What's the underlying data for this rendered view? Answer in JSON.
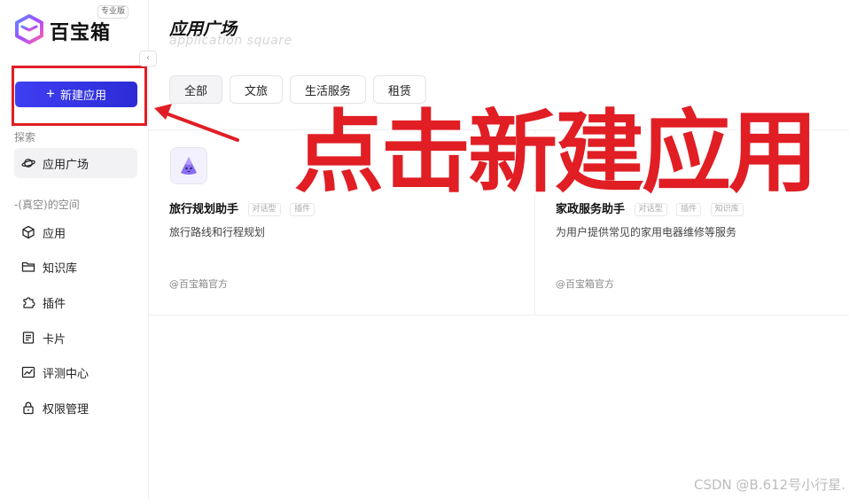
{
  "brand": {
    "name": "百宝箱",
    "edition_badge": "专业版"
  },
  "sidebar": {
    "collapse_icon": "chevron-left-icon",
    "new_app_label": "新建应用",
    "explore_section": "探索",
    "explore_items": [
      {
        "label": "应用广场",
        "icon": "planet-icon"
      }
    ],
    "space_section": "-(真空)的空间",
    "space_items": [
      {
        "label": "应用",
        "icon": "cube-icon"
      },
      {
        "label": "知识库",
        "icon": "folder-icon"
      },
      {
        "label": "插件",
        "icon": "puzzle-icon"
      },
      {
        "label": "卡片",
        "icon": "card-icon"
      },
      {
        "label": "评测中心",
        "icon": "chart-icon"
      },
      {
        "label": "权限管理",
        "icon": "lock-icon"
      }
    ]
  },
  "main": {
    "title": "应用广场",
    "subtitle": "application square",
    "tabs": [
      {
        "label": "全部",
        "active": true
      },
      {
        "label": "文旅",
        "active": false
      },
      {
        "label": "生活服务",
        "active": false
      },
      {
        "label": "租赁",
        "active": false
      }
    ],
    "cards": [
      {
        "name": "旅行规划助手",
        "tags": [
          "对话型",
          "插件"
        ],
        "description": "旅行路线和行程规划",
        "author": "@百宝箱官方"
      },
      {
        "name": "家政服务助手",
        "tags": [
          "对话型",
          "插件",
          "知识库"
        ],
        "description": "为用户提供常见的家用电器维修等服务",
        "author": "@百宝箱官方"
      }
    ]
  },
  "annotation": {
    "text": "点击新建应用",
    "color": "#e01e24"
  },
  "watermark": "CSDN @B.612号小行星.",
  "colors": {
    "primary": "#3535e6",
    "annotation_red": "#e01e24"
  }
}
